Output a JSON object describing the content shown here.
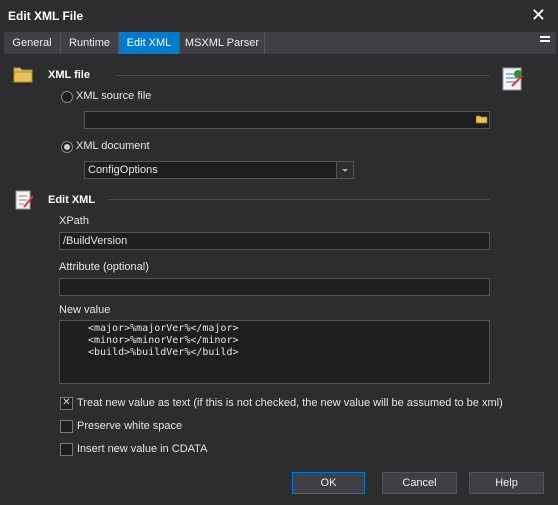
{
  "window": {
    "title": "Edit XML File",
    "close_glyph": "✕"
  },
  "tabs": [
    {
      "label": "General"
    },
    {
      "label": "Runtime"
    },
    {
      "label": "Edit XML"
    },
    {
      "label": "MSXML Parser"
    }
  ],
  "xml_file": {
    "section_title": "XML file",
    "source_file_label": "XML source file",
    "source_file_value": "",
    "document_label": "XML document",
    "document_value": "ConfigOptions"
  },
  "edit_xml": {
    "section_title": "Edit XML",
    "xpath_label": "XPath",
    "xpath_value": "/BuildVersion",
    "attribute_label": "Attribute (optional)",
    "attribute_value": "",
    "new_value_label": "New value",
    "new_value_lines": [
      "<major>%majorVer%</major>",
      "<minor>%minorVer%</minor>",
      "<build>%buildVer%</build>"
    ]
  },
  "options": {
    "treat_as_text_label": "Treat new value as text (if this is not checked, the new value will be assumed to be xml)",
    "treat_as_text_checked": true,
    "preserve_whitespace_label": "Preserve white space",
    "preserve_whitespace_checked": false,
    "cdata_label": "Insert new value in CDATA",
    "cdata_checked": false
  },
  "buttons": {
    "ok": "OK",
    "cancel": "Cancel",
    "help": "Help"
  }
}
